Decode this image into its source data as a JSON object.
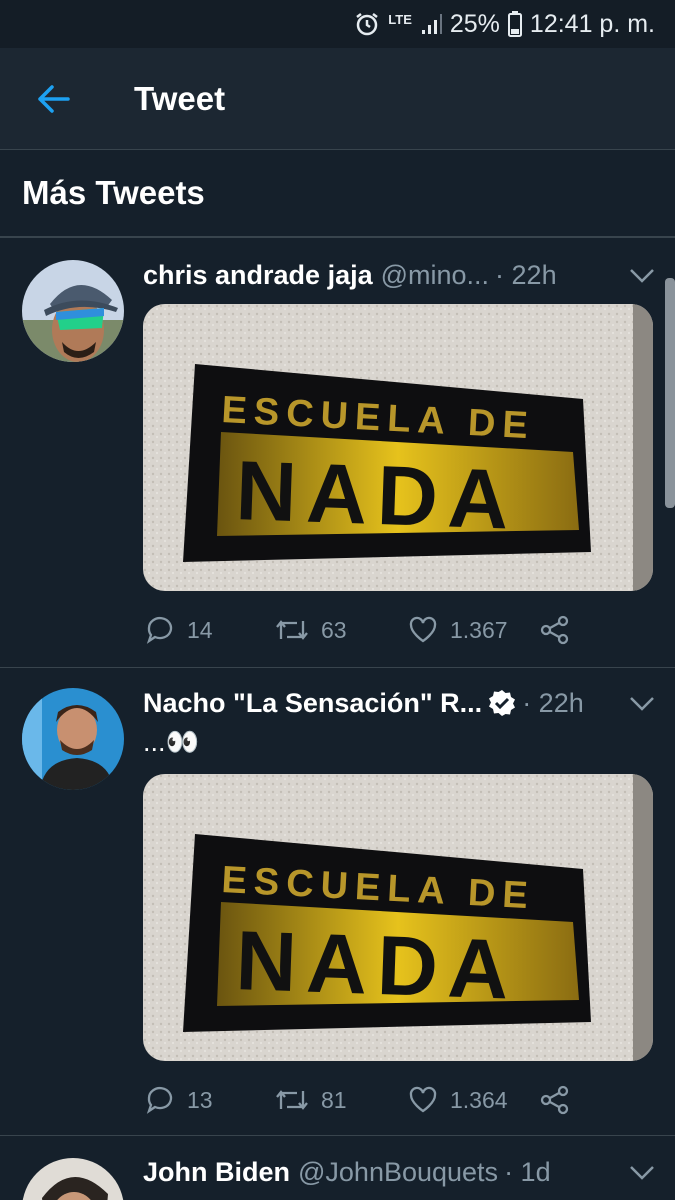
{
  "status": {
    "network": "LTE",
    "battery": "25%",
    "time": "12:41 p. m."
  },
  "topbar": {
    "title": "Tweet"
  },
  "section": {
    "title": "Más Tweets"
  },
  "tweets": [
    {
      "name": "chris andrade jaja",
      "handle": "@mino...",
      "time": "· 22h",
      "text": "",
      "image_text": [
        "ESCUELA DE",
        "NADA"
      ],
      "replies": "14",
      "retweets": "63",
      "likes": "1.367"
    },
    {
      "name": "Nacho \"La Sensación\" R...",
      "handle": "",
      "verified": true,
      "time": "· 22h",
      "text": "...👀",
      "image_text": [
        "ESCUELA DE",
        "NADA"
      ],
      "replies": "13",
      "retweets": "81",
      "likes": "1.364"
    },
    {
      "name": "John Biden",
      "handle": "@JohnBouquets",
      "time": "· 1d",
      "text": ""
    }
  ],
  "colors": {
    "background": "#15202b",
    "accent": "#1da1f2",
    "muted": "#8899a6",
    "divider": "#38444d"
  }
}
